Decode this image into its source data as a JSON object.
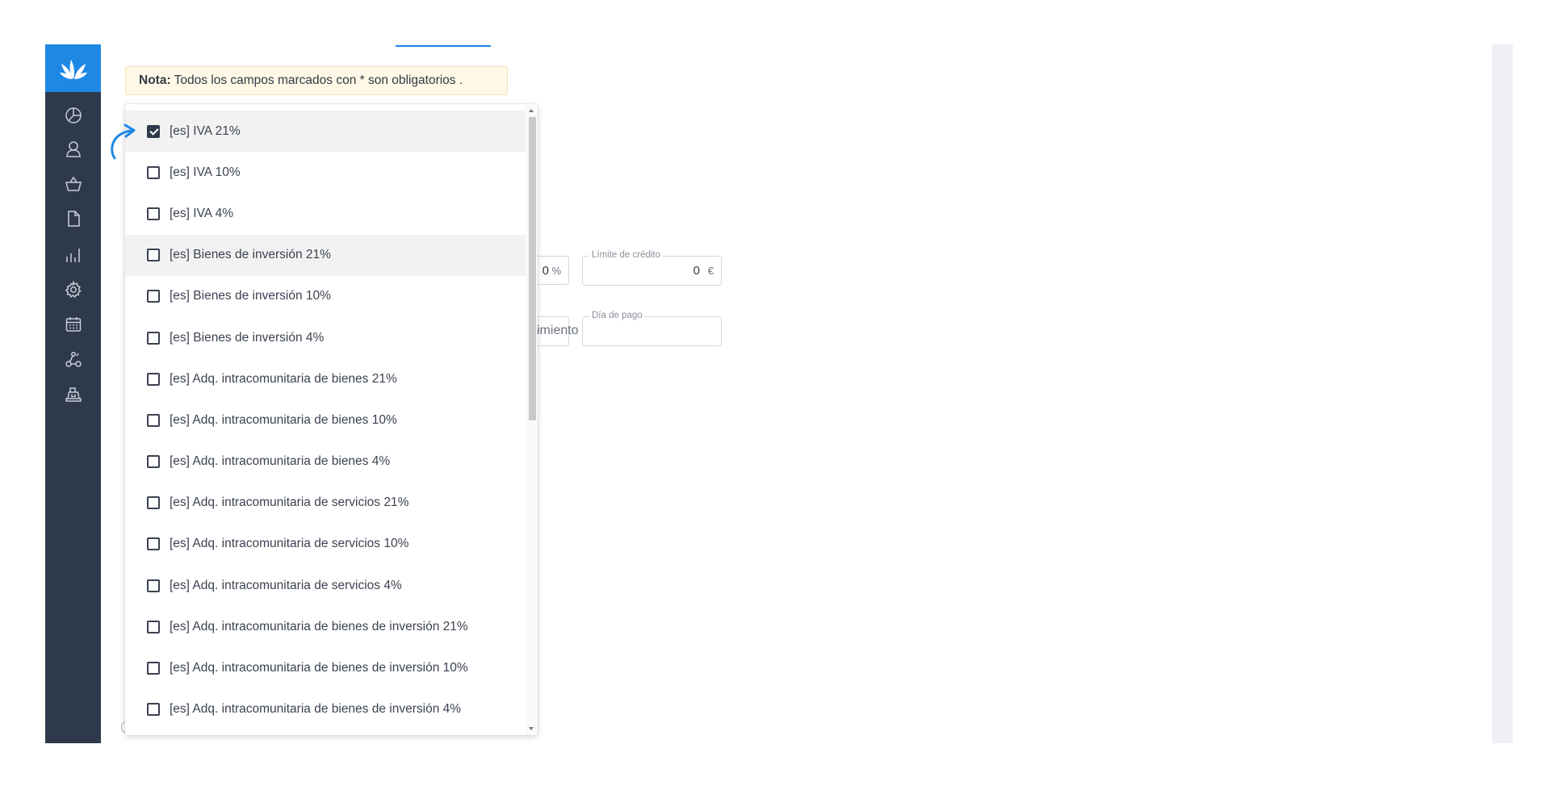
{
  "note": {
    "label": "Nota:",
    "text": "Todos los campos marcados con * son obligatorios ."
  },
  "sidebar": {
    "logo": "leaf-logo",
    "items": [
      {
        "icon": "dashboard-pie-icon"
      },
      {
        "icon": "user-icon"
      },
      {
        "icon": "shopping-basket-icon"
      },
      {
        "icon": "document-icon"
      },
      {
        "icon": "bar-chart-icon"
      },
      {
        "icon": "gear-icon"
      },
      {
        "icon": "calendar-icon"
      },
      {
        "icon": "integrations-icon"
      },
      {
        "icon": "cash-register-icon"
      }
    ]
  },
  "background_form": {
    "percent_value": "0",
    "percent_suffix": "%",
    "credit_limit_label": "Límite de crédito",
    "credit_limit_value": "0",
    "credit_limit_suffix": "€",
    "partial_due_text": "imiento",
    "payment_day_label": "Día de pago",
    "payment_day_value": ""
  },
  "dropdown": {
    "items": [
      {
        "label": "[es] IVA 21%",
        "checked": true
      },
      {
        "label": "[es] IVA 10%",
        "checked": false
      },
      {
        "label": "[es] IVA 4%",
        "checked": false
      },
      {
        "label": "[es] Bienes de inversión 21%",
        "checked": false
      },
      {
        "label": "[es] Bienes de inversión 10%",
        "checked": false
      },
      {
        "label": "[es] Bienes de inversión 4%",
        "checked": false
      },
      {
        "label": "[es] Adq. intracomunitaria de bienes 21%",
        "checked": false
      },
      {
        "label": "[es] Adq. intracomunitaria de bienes 10%",
        "checked": false
      },
      {
        "label": "[es] Adq. intracomunitaria de bienes 4%",
        "checked": false
      },
      {
        "label": "[es] Adq. intracomunitaria de servicios 21%",
        "checked": false
      },
      {
        "label": "[es] Adq. intracomunitaria de servicios 10%",
        "checked": false
      },
      {
        "label": "[es] Adq. intracomunitaria de servicios 4%",
        "checked": false
      },
      {
        "label": "[es] Adq. intracomunitaria de bienes de inversión 21%",
        "checked": false
      },
      {
        "label": "[es] Adq. intracomunitaria de bienes de inversión 10%",
        "checked": false
      },
      {
        "label": "[es] Adq. intracomunitaria de bienes de inversión 4%",
        "checked": false
      }
    ]
  },
  "colors": {
    "sidebar": "#2e3a4b",
    "accent": "#1e88e5",
    "note_bg": "#fff8e6"
  }
}
